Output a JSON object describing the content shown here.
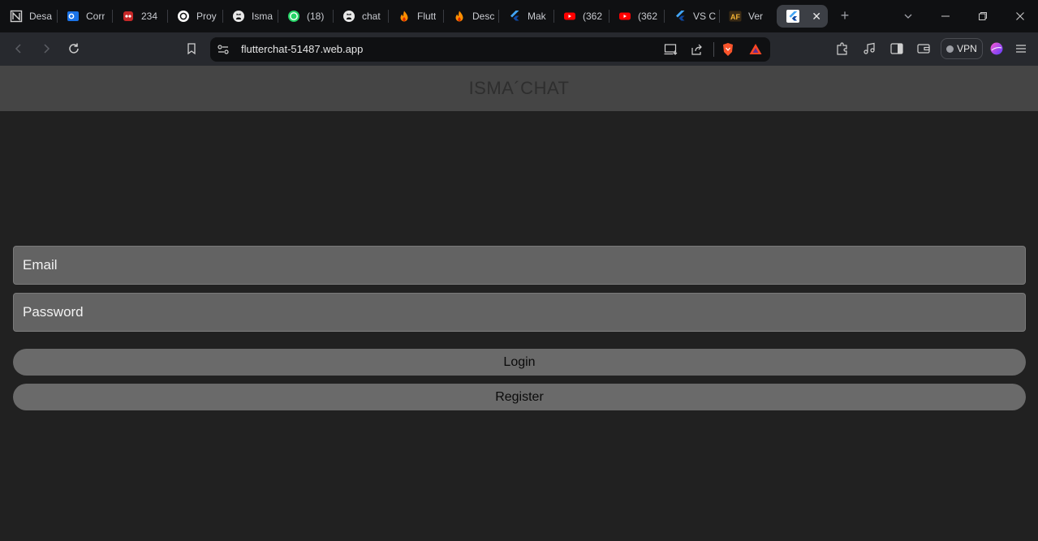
{
  "browser": {
    "tabs": [
      {
        "title": "Desa",
        "icon": "notion-icon"
      },
      {
        "title": "Corr",
        "icon": "outlook-icon"
      },
      {
        "title": "234",
        "icon": "app-icon"
      },
      {
        "title": "Proy",
        "icon": "openai-icon"
      },
      {
        "title": "Isma",
        "icon": "github-icon"
      },
      {
        "title": "(18)",
        "icon": "whatsapp-icon"
      },
      {
        "title": "chat",
        "icon": "github-icon"
      },
      {
        "title": "Flutt",
        "icon": "firebase-icon"
      },
      {
        "title": "Desc",
        "icon": "firebase-icon"
      },
      {
        "title": "Mak",
        "icon": "flutter-icon"
      },
      {
        "title": "(362",
        "icon": "youtube-icon"
      },
      {
        "title": "(362",
        "icon": "youtube-icon"
      },
      {
        "title": "VS C",
        "icon": "flutter-icon"
      },
      {
        "title": "Ver",
        "icon": "af-icon"
      },
      {
        "title": "",
        "icon": "flutter-icon",
        "active": true
      }
    ],
    "url": "flutterchat-51487.web.app",
    "vpn_label": "VPN"
  },
  "app": {
    "title": "ISMA´CHAT",
    "email_placeholder": "Email",
    "password_placeholder": "Password",
    "login_label": "Login",
    "register_label": "Register"
  },
  "colors": {
    "background": "#212121",
    "header": "#454545",
    "field": "#636363",
    "button": "#6a6a6a"
  }
}
